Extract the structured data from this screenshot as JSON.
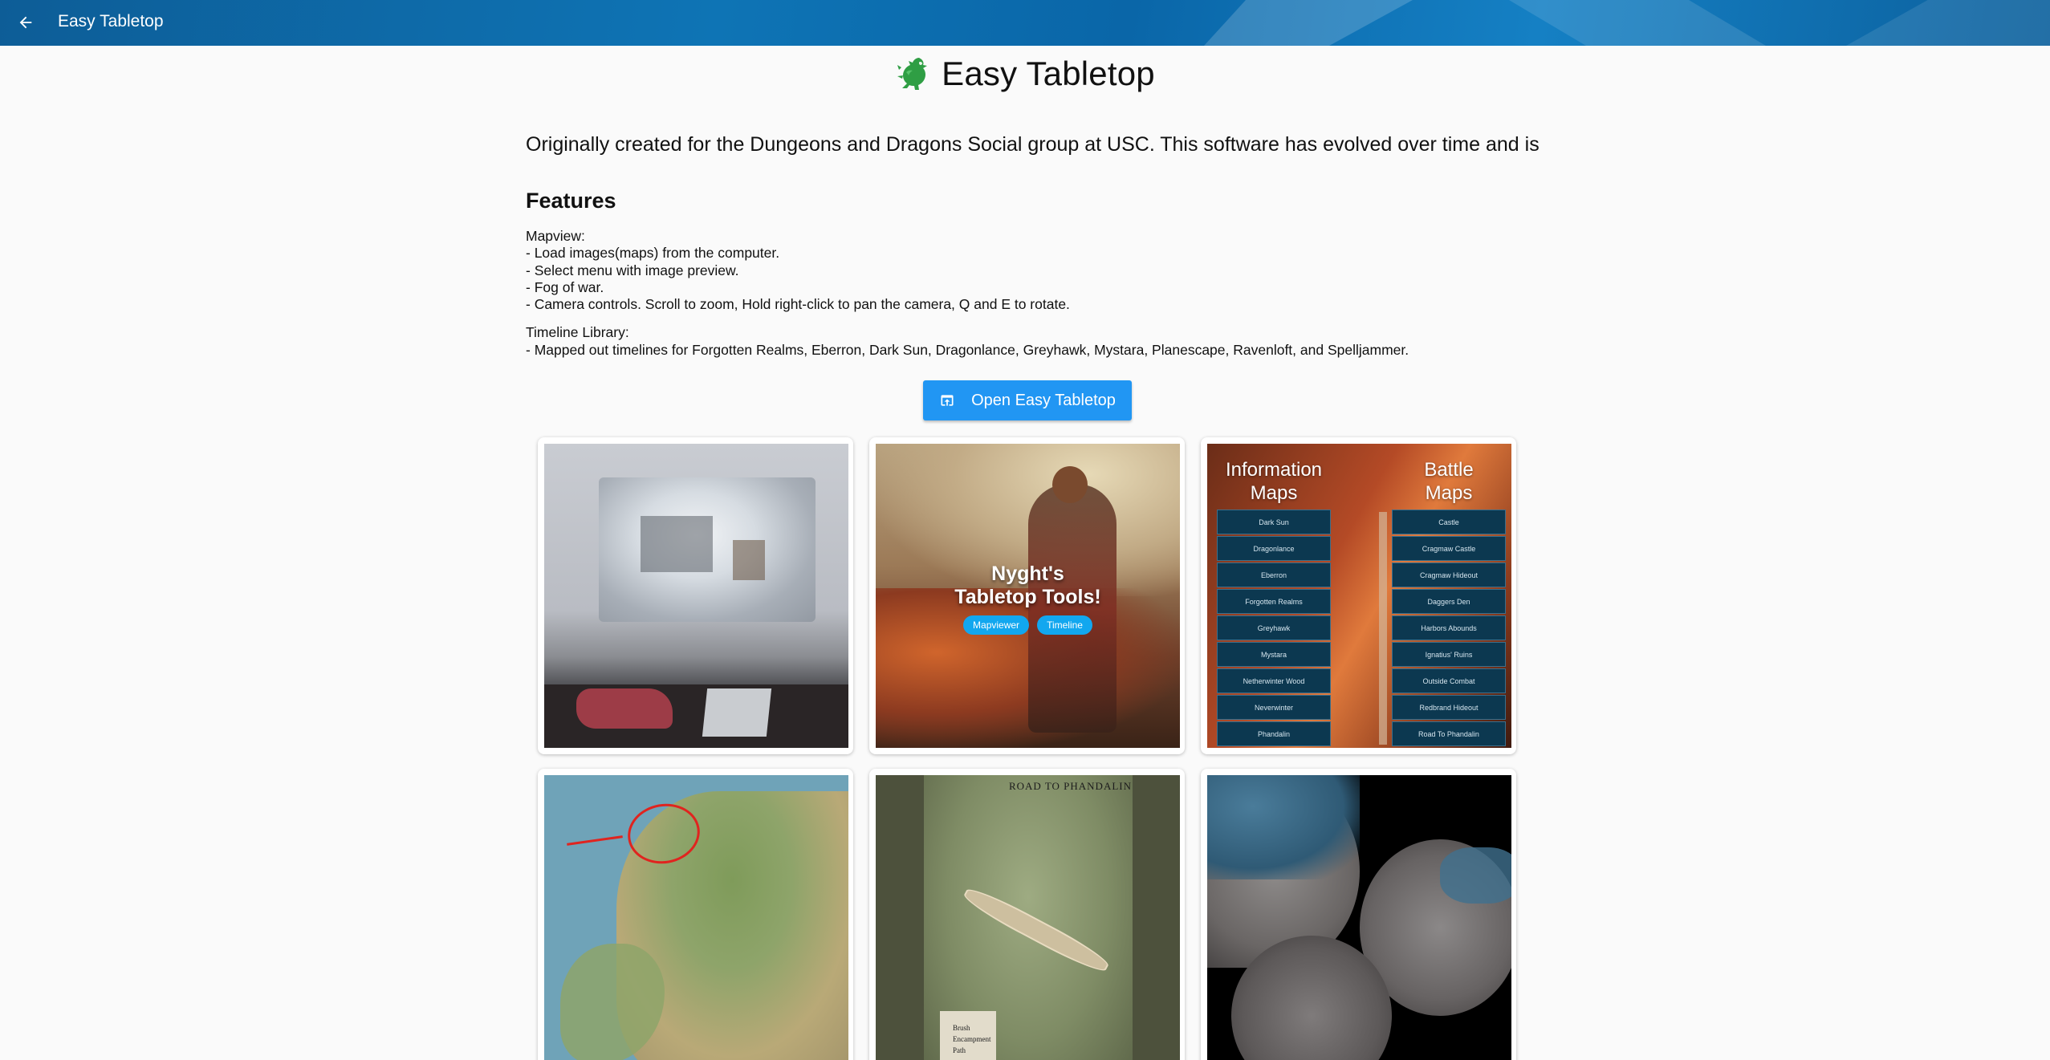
{
  "appbar": {
    "title": "Easy Tabletop",
    "back_icon": "arrow-left-icon"
  },
  "page": {
    "title": "Easy Tabletop",
    "logo_icon": "green-dragon-icon",
    "intro": "Originally created for the Dungeons and Dragons Social group at USC. This software has evolved over time and is",
    "features_heading": "Features",
    "mapview": {
      "heading": "Mapview:",
      "items": [
        "- Load images(maps) from the computer.",
        "- Select menu with image preview.",
        "- Fog of war.",
        "- Camera controls. Scroll to zoom, Hold right-click to pan the camera, Q and E to rotate."
      ]
    },
    "timeline": {
      "heading": "Timeline Library:",
      "items": [
        "- Mapped out timelines for Forgotten Realms, Eberron, Dark Sun, Dragonlance, Greyhawk, Mystara, Planescape, Ravenloft, and Spelljammer."
      ]
    },
    "open_button": {
      "label": "Open Easy Tabletop",
      "icon": "open-in-browser-icon",
      "color": "#2196f3"
    }
  },
  "gallery": {
    "painting": {
      "title_line1": "Nyght's",
      "title_line2": "Tabletop Tools!",
      "buttons": [
        "Mapviewer",
        "Timeline"
      ]
    },
    "menu": {
      "info_title_line1": "Information",
      "info_title_line2": "Maps",
      "battle_title_line1": "Battle",
      "battle_title_line2": "Maps",
      "info_items": [
        "Dark Sun",
        "Dragonlance",
        "Eberron",
        "Forgotten Realms",
        "Greyhawk",
        "Mystara",
        "Netherwinter Wood",
        "Neverwinter",
        "Phandalin"
      ],
      "battle_items": [
        "Castle",
        "Cragmaw Castle",
        "Cragmaw Hideout",
        "Daggers Den",
        "Harbors Abounds",
        "Ignatius' Ruins",
        "Outside Combat",
        "Redbrand Hideout",
        "Road To Phandalin"
      ]
    },
    "battlemap": {
      "map_title": "ROAD TO PHANDALIN",
      "legend": [
        "Brush",
        "Encampment",
        "Path"
      ]
    }
  }
}
